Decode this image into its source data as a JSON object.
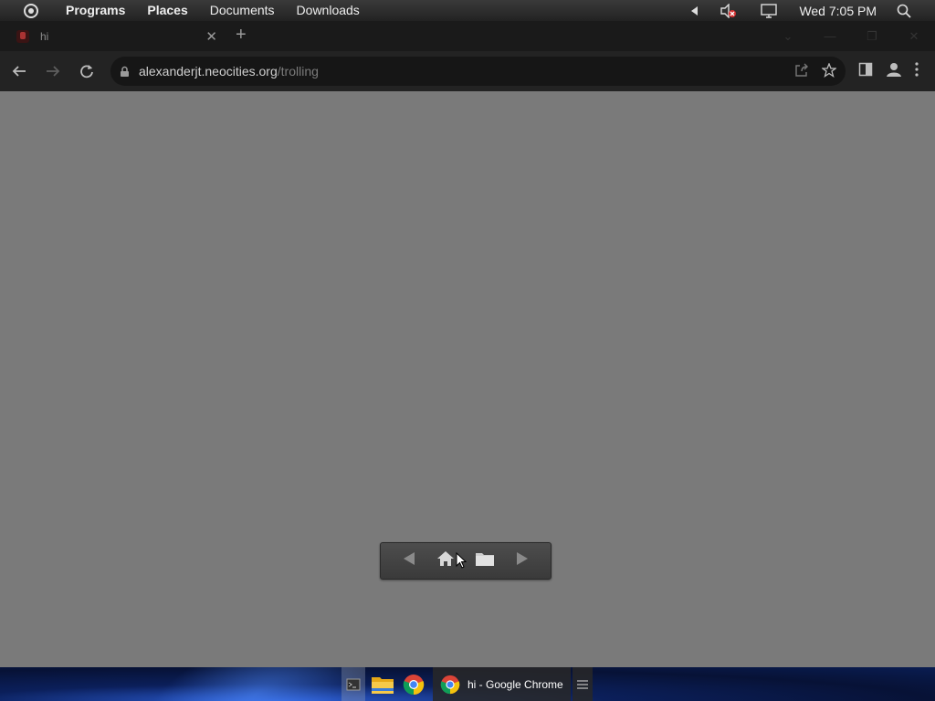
{
  "top_panel": {
    "menus": [
      "Programs",
      "Places",
      "Documents",
      "Downloads"
    ],
    "clock": "Wed 7:05 PM"
  },
  "browser": {
    "tab": {
      "title": "hi"
    },
    "url": {
      "host": "alexanderjt.neocities.org",
      "path": "/trolling"
    }
  },
  "taskbar": {
    "active_window_label": "hi - Google Chrome"
  },
  "colors": {
    "page_background": "#7a7a7a",
    "browser_frame": "#1c1c1c"
  }
}
